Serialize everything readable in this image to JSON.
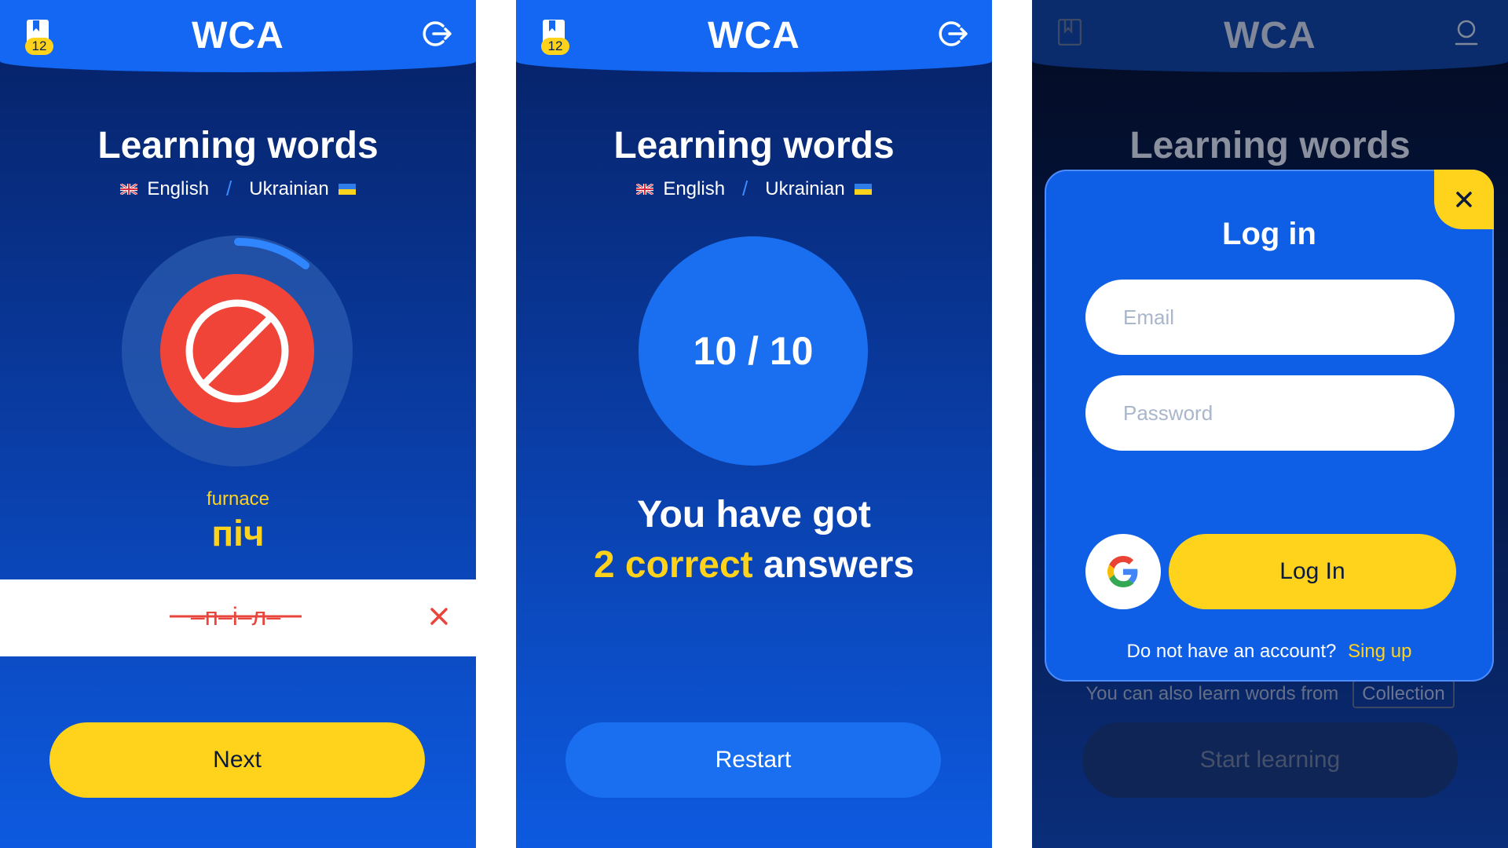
{
  "app": {
    "brand": "WCA",
    "bookmark_count": "12"
  },
  "page": {
    "title": "Learning words",
    "lang_from": "English",
    "lang_to": "Ukrainian"
  },
  "quiz": {
    "word_en": "furnace",
    "word_ua": "піч",
    "answer_text": "–п–і–л–",
    "next_label": "Next"
  },
  "result": {
    "score": "10 / 10",
    "line1": "You have got",
    "correct_highlight": "2 correct",
    "answers_word": "answers",
    "restart_label": "Restart"
  },
  "login": {
    "title": "Log in",
    "email_placeholder": "Email",
    "password_placeholder": "Password",
    "login_label": "Log In",
    "no_account_text": "Do not have an account?",
    "signup_label": "Sing up"
  },
  "background": {
    "hint_text": "You can also learn words from",
    "collection_label": "Collection",
    "start_label": "Start learning"
  },
  "colors": {
    "accent_yellow": "#ffd21c",
    "primary_blue": "#1367f2",
    "error_red": "#f04438"
  },
  "icons": [
    "bookmark-icon",
    "logout-icon",
    "user-icon",
    "forbidden-icon",
    "clear-icon",
    "close-icon",
    "google-icon",
    "uk-flag-icon",
    "ukraine-flag-icon"
  ]
}
